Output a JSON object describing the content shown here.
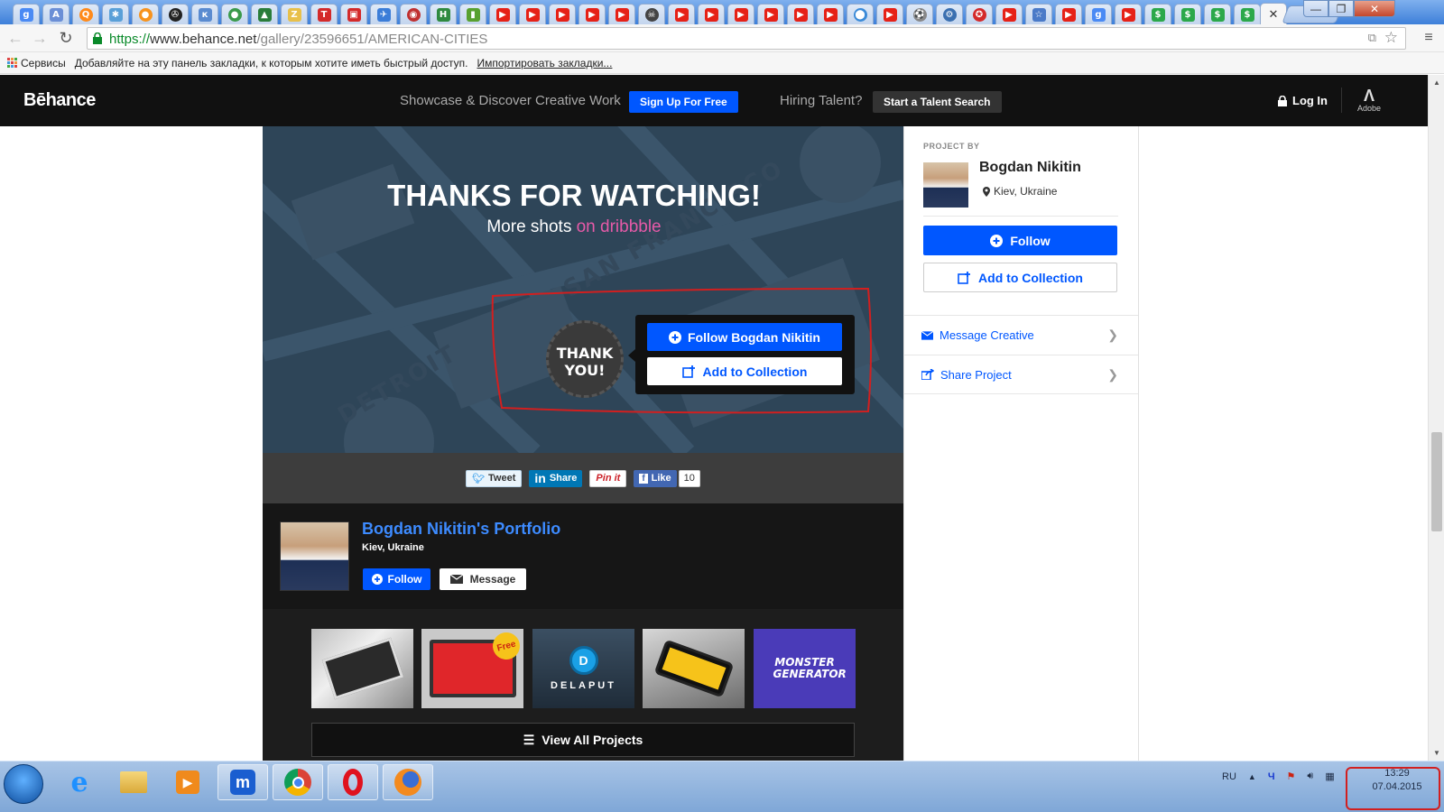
{
  "browser": {
    "url_https": "https://",
    "url_host": "www.behance.net",
    "url_path": "/gallery/23596651/AMERICAN-CITIES",
    "bookmarks": {
      "apps_label": "Сервисы",
      "hint": "Добавляйте на эту панель закладки, к которым хотите иметь быстрый доступ.",
      "import_link": "Импортировать закладки..."
    }
  },
  "header": {
    "logo": "Bēhance",
    "tagline": "Showcase & Discover Creative Work",
    "signup": "Sign Up For Free",
    "hiring": "Hiring Talent?",
    "talent_search": "Start a Talent Search",
    "login": "Log In",
    "adobe": "Adobe"
  },
  "hero": {
    "title": "THANKS FOR WATCHING!",
    "subtitle_prefix": "More shots ",
    "subtitle_link": "on dribbble",
    "badge_line1": "THANK",
    "badge_line2": "YOU!",
    "follow_button": "Follow Bogdan Nikitin",
    "collection_button": "Add to Collection"
  },
  "share": {
    "tweet": "Tweet",
    "linkedin": "Share",
    "pinterest": "Pin it",
    "facebook": "Like",
    "like_count": "10"
  },
  "portfolio": {
    "name": "Bogdan Nikitin's Portfolio",
    "location": "Kiev, Ukraine",
    "follow": "Follow",
    "message": "Message",
    "thumbs": [
      {
        "label": ""
      },
      {
        "label": "Free"
      },
      {
        "label": "DELAPUT"
      },
      {
        "label": ""
      },
      {
        "label": "MONSTER GENERATOR"
      }
    ],
    "view_all": "View All Projects"
  },
  "sidebar": {
    "project_by": "PROJECT BY",
    "name": "Bogdan Nikitin",
    "location": "Kiev, Ukraine",
    "follow": "Follow",
    "add_collection": "Add to Collection",
    "message_creative": "Message Creative",
    "share_project": "Share Project"
  },
  "taskbar": {
    "lang": "RU",
    "time": "13:29",
    "date": "07.04.2015"
  },
  "colors": {
    "behance_blue": "#0057ff",
    "header_bg": "#111111",
    "hero_bg": "#2e4558",
    "dribbble_pink": "#e65aa8",
    "annotation_red": "#d21f1f"
  }
}
